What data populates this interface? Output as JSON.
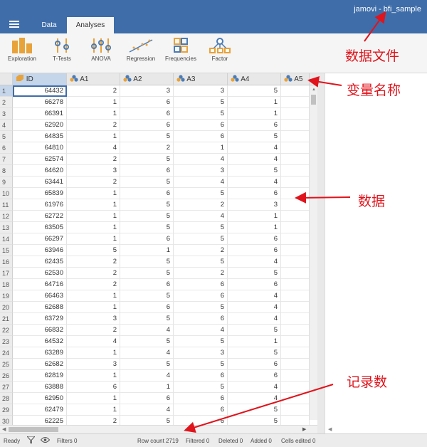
{
  "app": {
    "title": "jamovi - bfi_sample"
  },
  "tabs": [
    {
      "label": "Data"
    },
    {
      "label": "Analyses"
    }
  ],
  "ribbon": [
    {
      "label": "Exploration",
      "icon": "exploration-icon"
    },
    {
      "label": "T-Tests",
      "icon": "ttests-icon"
    },
    {
      "label": "ANOVA",
      "icon": "anova-icon"
    },
    {
      "label": "Regression",
      "icon": "regression-icon"
    },
    {
      "label": "Frequencies",
      "icon": "frequencies-icon"
    },
    {
      "label": "Factor",
      "icon": "factor-icon"
    }
  ],
  "grid": {
    "columns": [
      "ID",
      "A1",
      "A2",
      "A3",
      "A4",
      "A5"
    ],
    "rows": [
      [
        "1",
        "64432",
        "2",
        "3",
        "3",
        "5"
      ],
      [
        "2",
        "66278",
        "1",
        "6",
        "5",
        "1"
      ],
      [
        "3",
        "66391",
        "1",
        "6",
        "5",
        "1"
      ],
      [
        "4",
        "62920",
        "2",
        "6",
        "6",
        "6"
      ],
      [
        "5",
        "64835",
        "1",
        "5",
        "6",
        "5"
      ],
      [
        "6",
        "64810",
        "4",
        "2",
        "1",
        "4"
      ],
      [
        "7",
        "62574",
        "2",
        "5",
        "4",
        "4"
      ],
      [
        "8",
        "64620",
        "3",
        "6",
        "3",
        "5"
      ],
      [
        "9",
        "63441",
        "2",
        "5",
        "4",
        "4"
      ],
      [
        "10",
        "65839",
        "1",
        "6",
        "5",
        "6"
      ],
      [
        "11",
        "61976",
        "1",
        "5",
        "2",
        "3"
      ],
      [
        "12",
        "62722",
        "1",
        "5",
        "4",
        "1"
      ],
      [
        "13",
        "63505",
        "1",
        "5",
        "5",
        "1"
      ],
      [
        "14",
        "66297",
        "1",
        "6",
        "5",
        "6"
      ],
      [
        "15",
        "63946",
        "5",
        "1",
        "2",
        "6"
      ],
      [
        "16",
        "62435",
        "2",
        "5",
        "5",
        "4"
      ],
      [
        "17",
        "62530",
        "2",
        "5",
        "2",
        "5"
      ],
      [
        "18",
        "64716",
        "2",
        "6",
        "6",
        "6"
      ],
      [
        "19",
        "66463",
        "1",
        "5",
        "6",
        "4"
      ],
      [
        "20",
        "62688",
        "1",
        "6",
        "5",
        "4"
      ],
      [
        "21",
        "63729",
        "3",
        "5",
        "6",
        "4"
      ],
      [
        "22",
        "66832",
        "2",
        "4",
        "4",
        "5"
      ],
      [
        "23",
        "64532",
        "4",
        "5",
        "5",
        "1"
      ],
      [
        "24",
        "63289",
        "1",
        "4",
        "3",
        "5"
      ],
      [
        "25",
        "62682",
        "3",
        "5",
        "5",
        "6"
      ],
      [
        "26",
        "62819",
        "1",
        "4",
        "6",
        "6"
      ],
      [
        "27",
        "63888",
        "6",
        "1",
        "5",
        "4"
      ],
      [
        "28",
        "62950",
        "1",
        "6",
        "6",
        "4"
      ],
      [
        "29",
        "62479",
        "1",
        "4",
        "6",
        "5"
      ],
      [
        "30",
        "62225",
        "2",
        "5",
        "6",
        "5"
      ]
    ]
  },
  "status": {
    "ready": "Ready",
    "filters": "Filters 0",
    "row_count": "Row count 2719",
    "filtered": "Filtered 0",
    "deleted": "Deleted 0",
    "added": "Added 0",
    "cells_edited": "Cells edited 0"
  },
  "annotations": {
    "data_file": "数据文件",
    "variable_names": "变量名称",
    "data": "数据",
    "record_count": "记录数"
  },
  "colors": {
    "brand": "#3e6da9",
    "annotation": "#e0141c"
  }
}
